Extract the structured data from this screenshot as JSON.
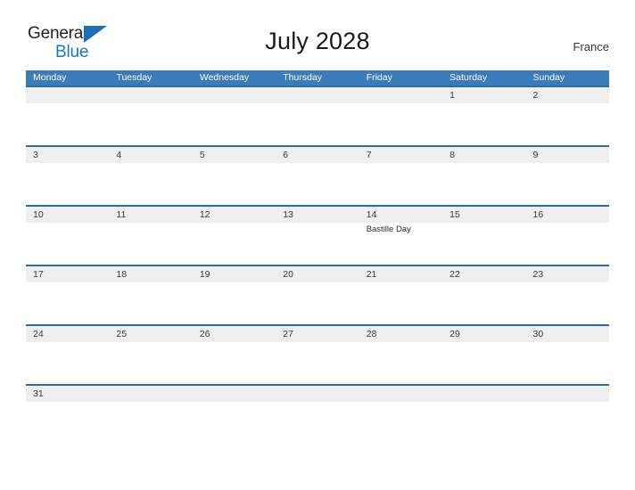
{
  "branding": {
    "name_line1": "General",
    "name_line2": "Blue",
    "flag_icon": "blue-triangle-flag",
    "accent_color": "#1a76c4"
  },
  "header": {
    "title": "July 2028",
    "country": "France"
  },
  "colors": {
    "header_band": "#3a7cb9",
    "row_divider": "#2a6ba8",
    "day_band": "#efefef",
    "page_background": "#ffffff"
  },
  "weekday_headers": [
    "Monday",
    "Tuesday",
    "Wednesday",
    "Thursday",
    "Friday",
    "Saturday",
    "Sunday"
  ],
  "weeks": [
    [
      {
        "day": "",
        "events": []
      },
      {
        "day": "",
        "events": []
      },
      {
        "day": "",
        "events": []
      },
      {
        "day": "",
        "events": []
      },
      {
        "day": "",
        "events": []
      },
      {
        "day": "1",
        "events": []
      },
      {
        "day": "2",
        "events": []
      }
    ],
    [
      {
        "day": "3",
        "events": []
      },
      {
        "day": "4",
        "events": []
      },
      {
        "day": "5",
        "events": []
      },
      {
        "day": "6",
        "events": []
      },
      {
        "day": "7",
        "events": []
      },
      {
        "day": "8",
        "events": []
      },
      {
        "day": "9",
        "events": []
      }
    ],
    [
      {
        "day": "10",
        "events": []
      },
      {
        "day": "11",
        "events": []
      },
      {
        "day": "12",
        "events": []
      },
      {
        "day": "13",
        "events": []
      },
      {
        "day": "14",
        "events": [
          "Bastille Day"
        ]
      },
      {
        "day": "15",
        "events": []
      },
      {
        "day": "16",
        "events": []
      }
    ],
    [
      {
        "day": "17",
        "events": []
      },
      {
        "day": "18",
        "events": []
      },
      {
        "day": "19",
        "events": []
      },
      {
        "day": "20",
        "events": []
      },
      {
        "day": "21",
        "events": []
      },
      {
        "day": "22",
        "events": []
      },
      {
        "day": "23",
        "events": []
      }
    ],
    [
      {
        "day": "24",
        "events": []
      },
      {
        "day": "25",
        "events": []
      },
      {
        "day": "26",
        "events": []
      },
      {
        "day": "27",
        "events": []
      },
      {
        "day": "28",
        "events": []
      },
      {
        "day": "29",
        "events": []
      },
      {
        "day": "30",
        "events": []
      }
    ],
    [
      {
        "day": "31",
        "events": []
      },
      {
        "day": "",
        "events": []
      },
      {
        "day": "",
        "events": []
      },
      {
        "day": "",
        "events": []
      },
      {
        "day": "",
        "events": []
      },
      {
        "day": "",
        "events": []
      },
      {
        "day": "",
        "events": []
      }
    ]
  ]
}
